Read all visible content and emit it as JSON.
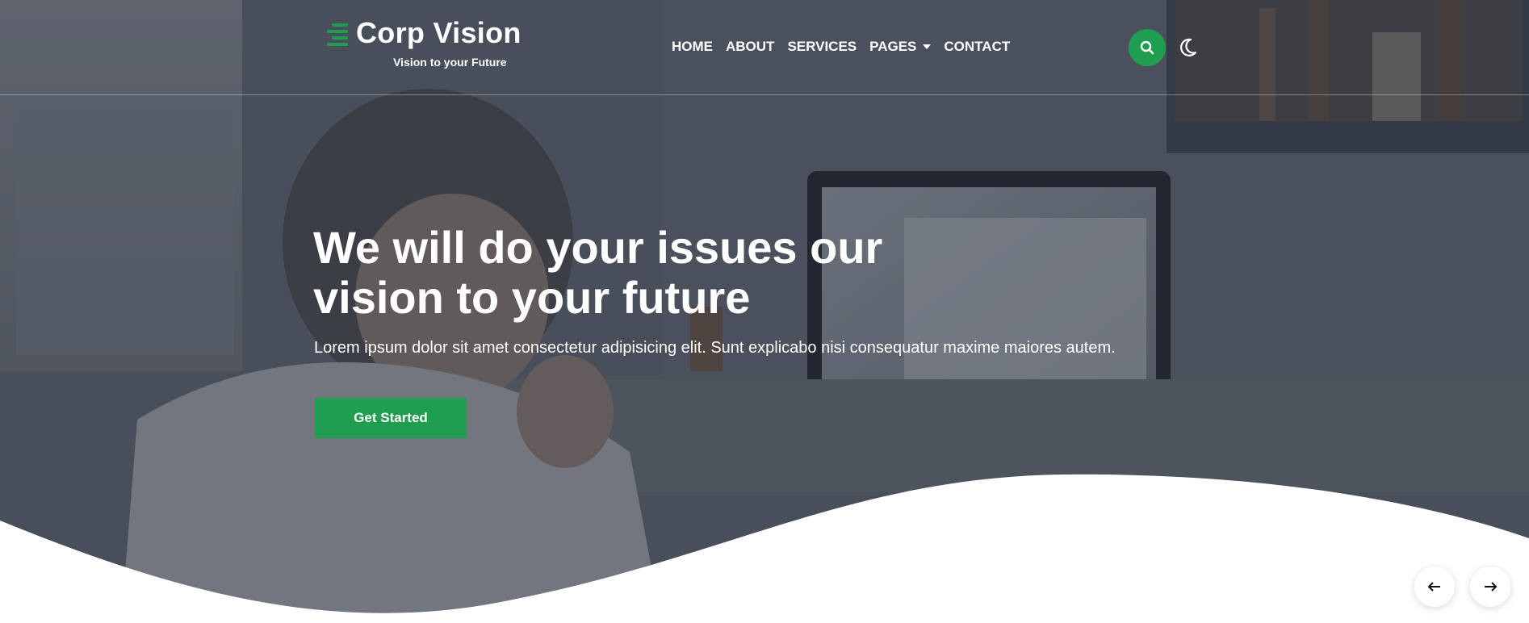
{
  "brand": {
    "name": "Corp Vision",
    "tagline": "Vision to your Future",
    "logo_icon": "bars-icon",
    "accent_color": "#1f9e4f"
  },
  "nav": {
    "items": [
      {
        "label": "HOME"
      },
      {
        "label": "ABOUT"
      },
      {
        "label": "SERVICES"
      },
      {
        "label": "PAGES",
        "has_dropdown": true
      },
      {
        "label": "CONTACT"
      }
    ]
  },
  "header_actions": {
    "search_icon": "search-icon",
    "theme_icon": "moon-icon"
  },
  "hero": {
    "headline_line1": "We will do your issues our",
    "headline_line2": "vision to your future",
    "subtext": "Lorem ipsum dolor sit amet consectetur adipisicing elit. Sunt explicabo nisi consequatur maxime maiores autem.",
    "cta_label": "Get Started"
  },
  "carousel": {
    "prev_icon": "arrow-left-icon",
    "next_icon": "arrow-right-icon"
  }
}
